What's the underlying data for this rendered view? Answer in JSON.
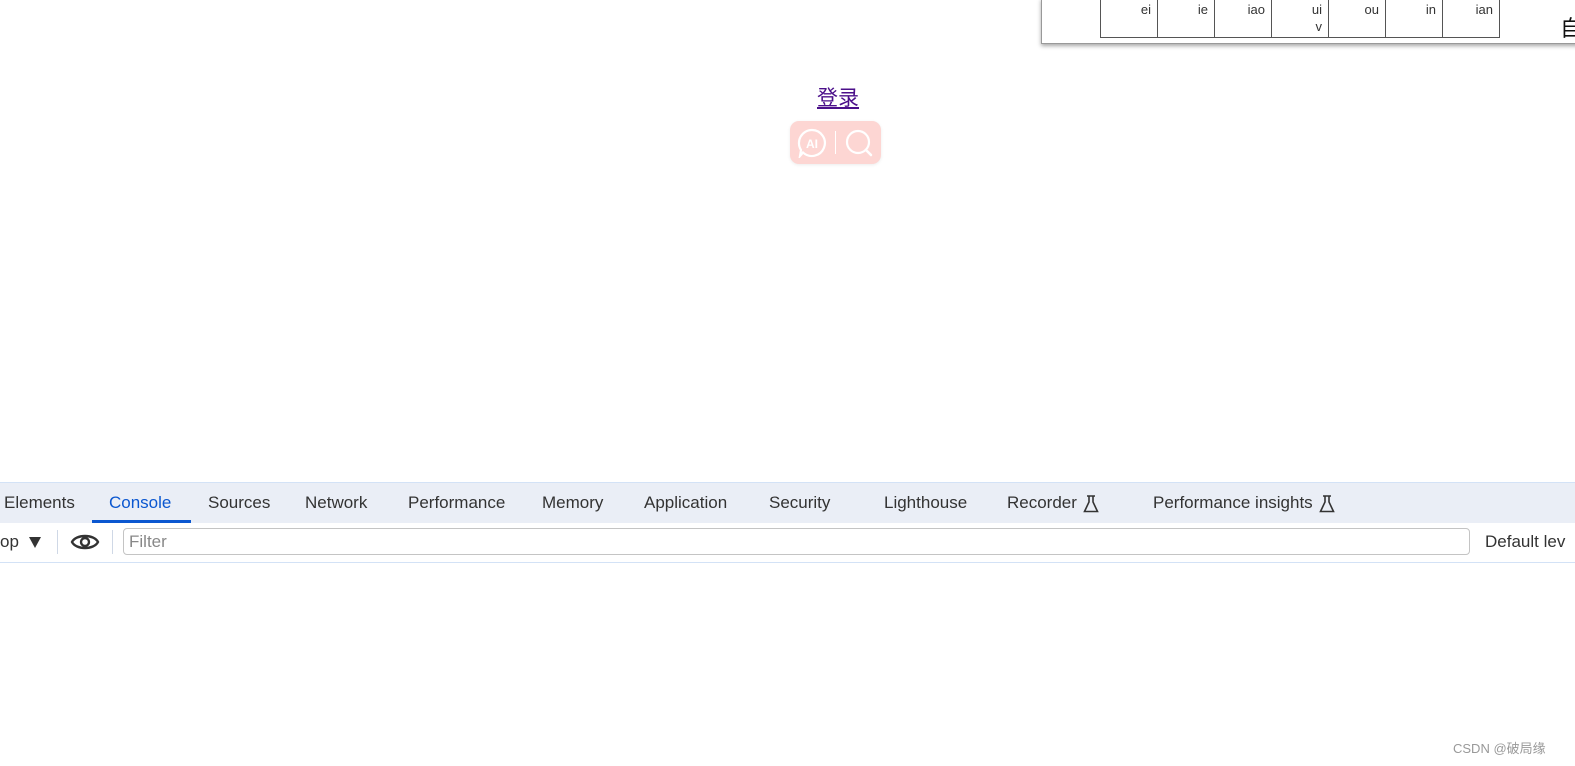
{
  "popup": {
    "table_cells": [
      [
        "ei"
      ],
      [
        "ie"
      ],
      [
        "iao"
      ],
      [
        "ui",
        "v"
      ],
      [
        "ou"
      ],
      [
        "in"
      ],
      [
        "ian"
      ]
    ],
    "partial_char": "自"
  },
  "page": {
    "login_link": "登录",
    "ai_search_widget": {
      "ai_icon": "ai-chat-icon",
      "search_icon": "search-icon",
      "color": "#fdd6d3"
    }
  },
  "devtools": {
    "tabs": [
      {
        "label": "Elements"
      },
      {
        "label": "Console",
        "active": true
      },
      {
        "label": "Sources"
      },
      {
        "label": "Network"
      },
      {
        "label": "Performance"
      },
      {
        "label": "Memory"
      },
      {
        "label": "Application"
      },
      {
        "label": "Security"
      },
      {
        "label": "Lighthouse"
      },
      {
        "label": "Recorder",
        "icon": "flask-icon"
      },
      {
        "label": "Performance insights",
        "icon": "flask-icon"
      }
    ],
    "accent": "#0b57d0",
    "toolbar": {
      "context": "op",
      "filter_placeholder": "Filter",
      "filter_value": "",
      "levels": "Default lev"
    }
  },
  "watermark": "CSDN @破局缘"
}
